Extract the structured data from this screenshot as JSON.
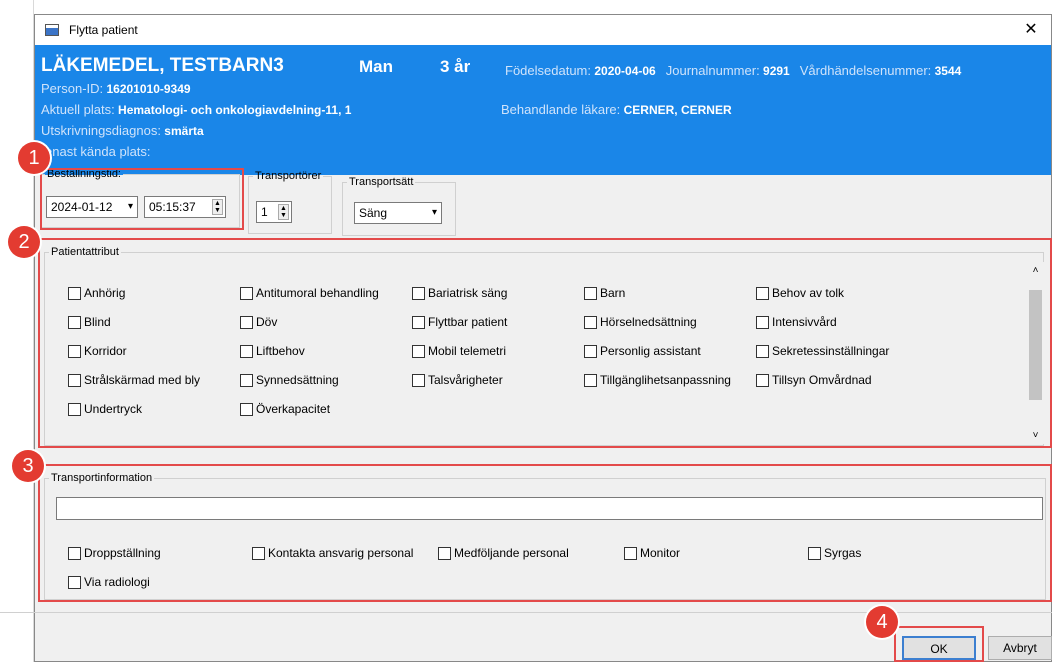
{
  "window": {
    "title": "Flytta patient",
    "close_glyph": "✕"
  },
  "patient": {
    "name": "LÄKEMEDEL, TESTBARN3",
    "sex": "Man",
    "age": "3 år",
    "birth_label": "Födelsedatum:",
    "birth_value": "2020-04-06",
    "journal_label": "Journalnummer:",
    "journal_value": "9291",
    "event_label": "Vårdhändelsenummer:",
    "event_value": "3544",
    "pid_label": "Person-ID:",
    "pid_value": "16201010-9349",
    "location_label": "Aktuell plats:",
    "location_value": "Hematologi- och onkologiavdelning-11, 1",
    "doctor_label": "Behandlande läkare:",
    "doctor_value": "CERNER, CERNER",
    "diagnosis_label": "Utskrivningsdiagnos:",
    "diagnosis_value": "smärta",
    "last_known_label": "enast kända plats:"
  },
  "order": {
    "label": "Beställningstid:",
    "date": "2024-01-12",
    "time": "05:15:37"
  },
  "transporters": {
    "label": "Transportörer",
    "value": "1"
  },
  "transport_mode": {
    "label": "Transportsätt",
    "value": "Säng"
  },
  "attributes": {
    "label": "Patientattribut",
    "items": [
      "Anhörig",
      "Antitumoral behandling",
      "Bariatrisk säng",
      "Barn",
      "Behov av tolk",
      "Blind",
      "Döv",
      "Flyttbar patient",
      "Hörselnedsättning",
      "Intensivvård",
      "Korridor",
      "Liftbehov",
      "Mobil telemetri",
      "Personlig assistant",
      "Sekretessinställningar",
      "Strålskärmad med bly",
      "Synnedsättning",
      "Talsvårigheter",
      "Tillgänglihetsanpassning",
      "Tillsyn Omvårdnad",
      "Undertryck",
      "Överkapacitet"
    ]
  },
  "transport_info": {
    "label": "Transportinformation",
    "input_value": "",
    "items": [
      "Droppställning",
      "Kontakta ansvarig personal",
      "Medföljande personal",
      "Monitor",
      "Syrgas",
      "Via radiologi"
    ]
  },
  "buttons": {
    "ok": "OK",
    "cancel": "Avbryt"
  },
  "badges": [
    "1",
    "2",
    "3",
    "4"
  ],
  "colors": {
    "header_bg": "#1a86e8",
    "annotation_red": "#e34a4a",
    "badge_red": "#e33b31"
  }
}
